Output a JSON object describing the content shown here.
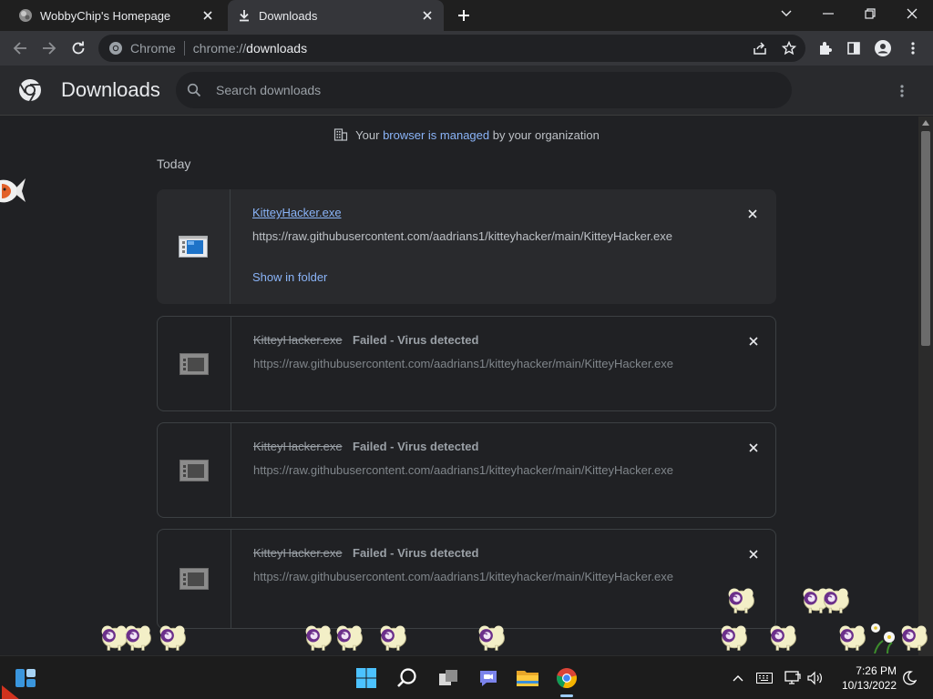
{
  "browser": {
    "tabs": [
      {
        "label": "WobbyChip's Homepage",
        "icon": "globe-favicon",
        "active": false
      },
      {
        "label": "Downloads",
        "icon": "download-favicon",
        "active": true
      }
    ],
    "address": {
      "chip": "Chrome",
      "scheme": "chrome://",
      "host": "downloads"
    }
  },
  "downloads": {
    "title": "Downloads",
    "search_placeholder": "Search downloads",
    "managed_notice": {
      "prefix": "Your ",
      "link": "browser is managed",
      "suffix": " by your organization"
    },
    "section": "Today",
    "items": [
      {
        "filename": "KitteyHacker.exe",
        "status": "",
        "url": "https://raw.githubusercontent.com/aadrians1/kitteyhacker/main/KitteyHacker.exe",
        "action": "Show in folder",
        "state": "complete"
      },
      {
        "filename": "KitteyHacker.exe",
        "status": "Failed - Virus detected",
        "url": "https://raw.githubusercontent.com/aadrians1/kitteyhacker/main/KitteyHacker.exe",
        "action": "",
        "state": "failed"
      },
      {
        "filename": "KitteyHacker.exe",
        "status": "Failed - Virus detected",
        "url": "https://raw.githubusercontent.com/aadrians1/kitteyhacker/main/KitteyHacker.exe",
        "action": "",
        "state": "failed"
      },
      {
        "filename": "KitteyHacker.exe",
        "status": "Failed - Virus detected",
        "url": "https://raw.githubusercontent.com/aadrians1/kitteyhacker/main/KitteyHacker.exe",
        "action": "",
        "state": "failed"
      }
    ]
  },
  "taskbar": {
    "time": "7:26 PM",
    "date": "10/13/2022",
    "apps": [
      "windows-start-icon",
      "search-icon",
      "task-view-icon",
      "chat-icon",
      "file-explorer-icon",
      "chrome-icon"
    ]
  },
  "colors": {
    "accent": "#8ab4f8",
    "background": "#202124",
    "toolbar": "#35363a"
  }
}
